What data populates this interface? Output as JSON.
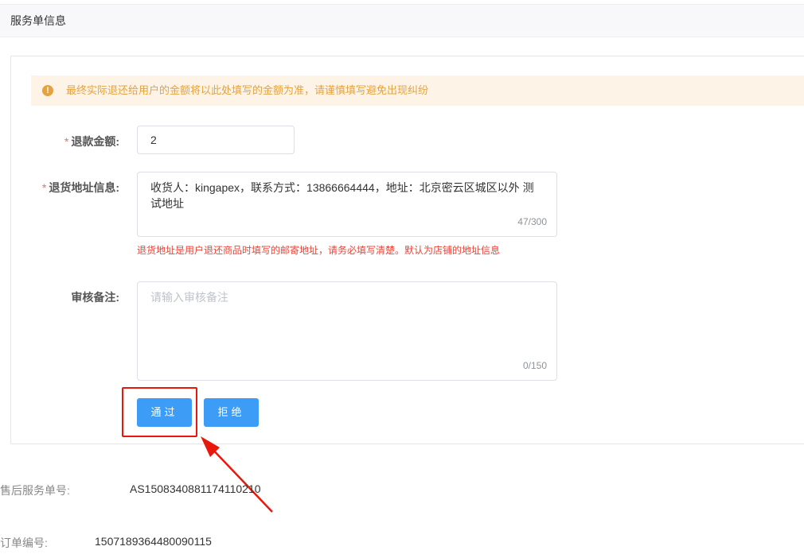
{
  "section_title": "服务单信息",
  "notice": {
    "icon": "exclamation-circle-icon",
    "text": "最终实际退还给用户的金额将以此处填写的金额为准，请谨慎填写避免出现纠纷"
  },
  "form": {
    "refund_amount": {
      "required_mark": "*",
      "label": "退款金额:",
      "value": "2"
    },
    "return_address": {
      "required_mark": "*",
      "label": "退货地址信息:",
      "value": "收货人：kingapex，联系方式：13866664444，地址：北京密云区城区以外 测试地址",
      "count": "47/300",
      "hint": "退货地址是用户退还商品时填写的邮寄地址，请务必填写清楚。默认为店铺的地址信息"
    },
    "review_note": {
      "label": "审核备注:",
      "placeholder": "请输入审核备注",
      "count": "0/150"
    },
    "approve_label": "通过",
    "reject_label": "拒绝"
  },
  "details": {
    "service_no_label": "售后服务单号:",
    "service_no_value": "AS1508340881174110210",
    "order_no_label": "订单编号:",
    "order_no_value": "1507189364480090115"
  },
  "colors": {
    "primary": "#3d9cf5",
    "warning": "#e6a23c",
    "danger_hint": "#f04134",
    "annotation_red": "#e8190c"
  }
}
